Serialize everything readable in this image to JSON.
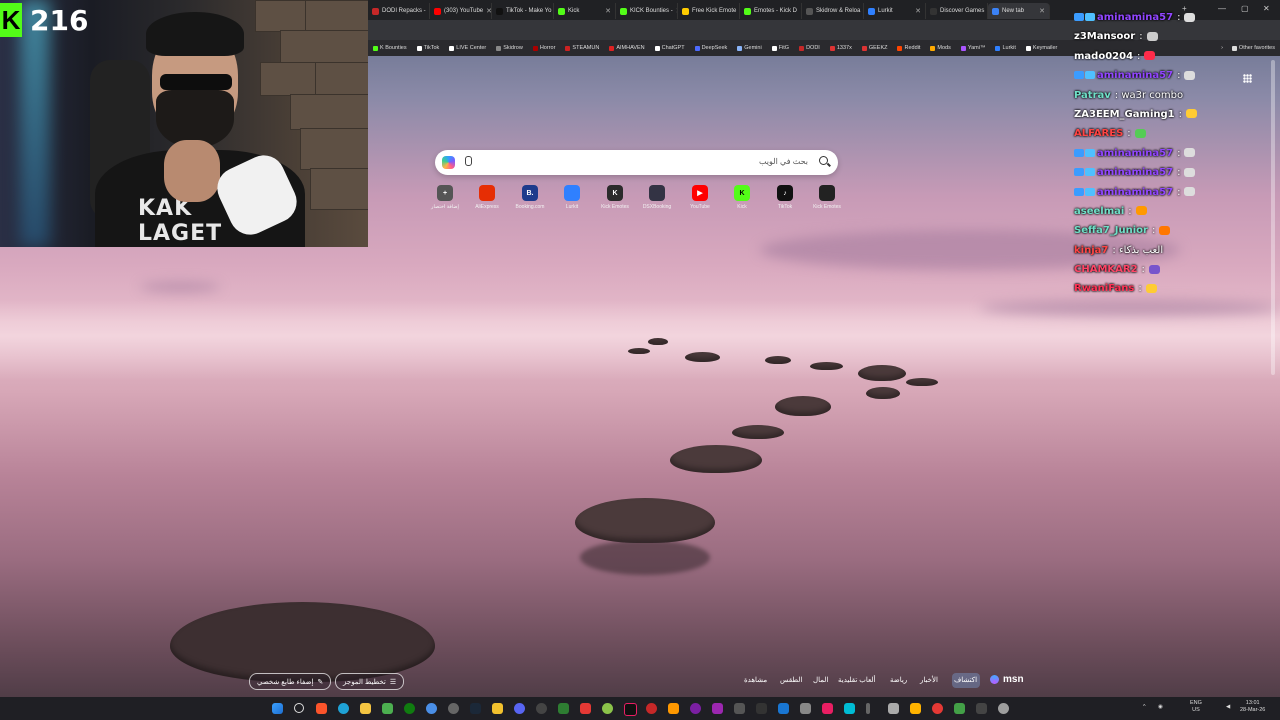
{
  "stream": {
    "viewer_count": "216"
  },
  "browser": {
    "tabs": [
      {
        "label": "DODI Repacks -",
        "color": "#c62828"
      },
      {
        "label": "(303) YouTube",
        "color": "#ff0000"
      },
      {
        "label": "TikTok - Make Yo",
        "color": "#111111"
      },
      {
        "label": "Kick",
        "color": "#53fc18"
      },
      {
        "label": "KICK Bounties -",
        "color": "#53fc18"
      },
      {
        "label": "Free Kick Emote",
        "color": "#ffcc00"
      },
      {
        "label": "Emotes - Kick D",
        "color": "#53fc18"
      },
      {
        "label": "Skidrow & Reloa",
        "color": "#555555"
      },
      {
        "label": "Lurkit",
        "color": "#2f80ff"
      },
      {
        "label": "Discover Games",
        "color": "#333333"
      },
      {
        "label": "New tab",
        "color": "#3b82f6"
      }
    ],
    "bookmarks": [
      {
        "label": "K Bounties",
        "color": "#53fc18"
      },
      {
        "label": "TikTok",
        "color": "#ffffff"
      },
      {
        "label": "LIVE Center",
        "color": "#ffffff"
      },
      {
        "label": "Skidrow",
        "color": "#888888"
      },
      {
        "label": "Horror",
        "color": "#aa0000"
      },
      {
        "label": "STEAMUN",
        "color": "#cc2222"
      },
      {
        "label": "AIMHAVEN",
        "color": "#dd2222"
      },
      {
        "label": "ChatGPT",
        "color": "#ffffff"
      },
      {
        "label": "DeepSeek",
        "color": "#4d6bfe"
      },
      {
        "label": "Gemini",
        "color": "#8ab4f8"
      },
      {
        "label": "FitG",
        "color": "#ffffff"
      },
      {
        "label": "DODI",
        "color": "#c62828"
      },
      {
        "label": "1337x",
        "color": "#d33"
      },
      {
        "label": "GEEKZ",
        "color": "#d33"
      },
      {
        "label": "Reddit",
        "color": "#ff4500"
      },
      {
        "label": "Mods",
        "color": "#ffaa00"
      },
      {
        "label": "Yami™",
        "color": "#aa55ff"
      },
      {
        "label": "Lurkit",
        "color": "#2f80ff"
      },
      {
        "label": "Keymailer",
        "color": "#ffffff"
      },
      {
        "label": "Other favorites",
        "color": "#dddddd"
      }
    ],
    "search": {
      "placeholder": "بحث في الويب"
    },
    "quick_links": [
      {
        "label": "إضافة اختصار",
        "letter": "+",
        "color": "#555555"
      },
      {
        "label": "AliExpress",
        "letter": "",
        "color": "#e62e04"
      },
      {
        "label": "Booking.com",
        "letter": "B.",
        "color": "#1d3b8c"
      },
      {
        "label": "Lurkit",
        "letter": "",
        "color": "#2f80ff"
      },
      {
        "label": "Kick Emotes",
        "letter": "K",
        "color": "#2b2b2b"
      },
      {
        "label": "DSXBooking",
        "letter": "",
        "color": "#333344"
      },
      {
        "label": "YouTube",
        "letter": "",
        "color": "#ff0000"
      },
      {
        "label": "Kick",
        "letter": "K",
        "color": "#53fc18"
      },
      {
        "label": "TikTok",
        "letter": "",
        "color": "#111111"
      },
      {
        "label": "Kick Emotes",
        "letter": "",
        "color": "#222222"
      }
    ]
  },
  "chat": [
    {
      "user": "aminamina57",
      "color": "#9146ff",
      "badges": 2,
      "text": ":",
      "emote": "#dddddd"
    },
    {
      "user": "z3Mansoor",
      "color": "#ffffff",
      "badges": 0,
      "text": ":",
      "emote": "#cccccc"
    },
    {
      "user": "mado0204",
      "color": "#ffffff",
      "badges": 0,
      "text": ":",
      "emote": "#ff2b4a"
    },
    {
      "user": "aminamina57",
      "color": "#9146ff",
      "badges": 2,
      "text": ":",
      "emote": "#dddddd"
    },
    {
      "user": "Patrav",
      "color": "#6fe0c8",
      "badges": 0,
      "text": ": wa3r combo",
      "emote": ""
    },
    {
      "user": "ZA3EEM_Gaming1",
      "color": "#ffffff",
      "badges": 0,
      "text": ":",
      "emote": "#ffcc33"
    },
    {
      "user": "ALFARES",
      "color": "#ff4444",
      "badges": 0,
      "text": ":",
      "emote": "#55cc55"
    },
    {
      "user": "aminamina57",
      "color": "#9146ff",
      "badges": 2,
      "text": ":",
      "emote": "#dddddd"
    },
    {
      "user": "aminamina57",
      "color": "#9146ff",
      "badges": 2,
      "text": ":",
      "emote": "#dddddd"
    },
    {
      "user": "aminamina57",
      "color": "#9146ff",
      "badges": 2,
      "text": ":",
      "emote": "#dddddd"
    },
    {
      "user": "aseelmai",
      "color": "#6fe0c8",
      "badges": 0,
      "text": ":",
      "emote": "#ff9900"
    },
    {
      "user": "Seffa7_Junior",
      "color": "#6fe0c8",
      "badges": 0,
      "text": ":",
      "emote": "#ff7700"
    },
    {
      "user": "kinja7",
      "color": "#ff4444",
      "badges": 0,
      "text": ": العب بذكاء",
      "emote": ""
    },
    {
      "user": "CHAMKAR2",
      "color": "#ff4466",
      "badges": 0,
      "text": ":",
      "emote": "#7755cc"
    },
    {
      "user": "RwaniFans",
      "color": "#ff3355",
      "badges": 0,
      "text": ":",
      "emote": "#ffcc33"
    }
  ],
  "msn": {
    "btn_personalize": "إضفاء طابع شخصي",
    "btn_layout": "تخطيط الموجز",
    "links": [
      "مشاهدة",
      "الطقس",
      "المال",
      "ألعاب تقليدية",
      "رياضة",
      "الأخبار",
      "اكتشاف"
    ],
    "logo": "msn"
  },
  "taskbar": {
    "lang": "ENG",
    "region": "US",
    "time": "13:01",
    "date": "28-Mar-26"
  }
}
